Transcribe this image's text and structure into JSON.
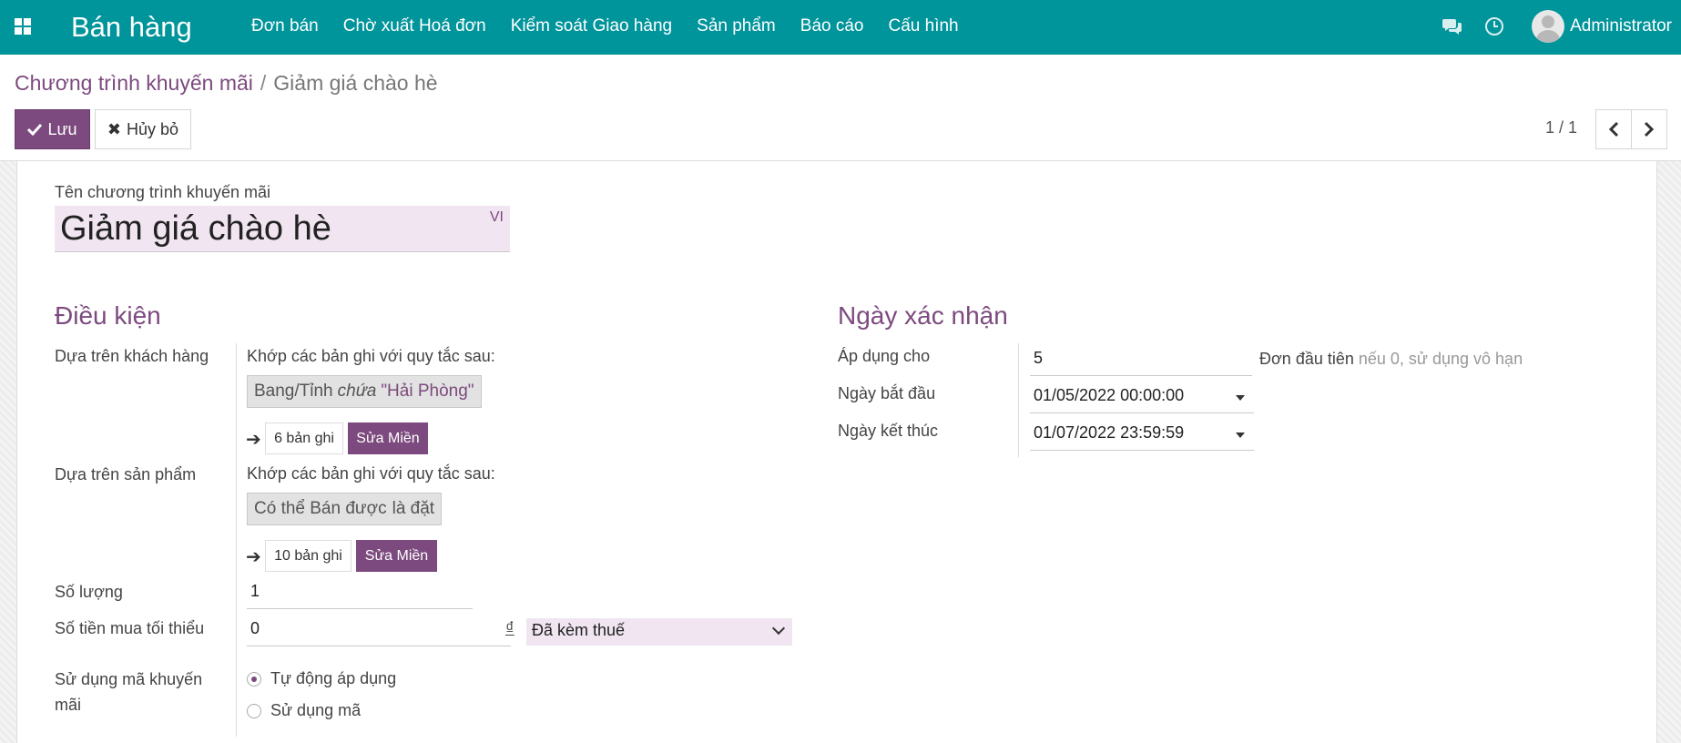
{
  "navbar": {
    "app_name": "Bán hàng",
    "menu": [
      "Đơn bán",
      "Chờ xuất Hoá đơn",
      "Kiểm soát Giao hàng",
      "Sản phẩm",
      "Báo cáo",
      "Cấu hình"
    ],
    "user": "Administrator",
    "bg_color": "#00949b",
    "icons": [
      "apps-icon",
      "chat-icon",
      "clock-icon",
      "avatar"
    ]
  },
  "breadcrumb": {
    "parent": "Chương trình khuyến mãi",
    "separator": "/",
    "current": "Giảm giá chào hè"
  },
  "buttons": {
    "save": "Lưu",
    "discard": "Hủy bỏ",
    "accent_color": "#7c4a7e"
  },
  "pager": {
    "value": "1 / 1"
  },
  "form": {
    "name_label": "Tên chương trình khuyến mãi",
    "name_value": "Giảm giá chào hè",
    "lang": "VI",
    "conditions": {
      "title": "Điều kiện",
      "customer_label": "Dựa trên khách hàng",
      "customer_rule_intro": "Khớp các bản ghi với quy tắc sau:",
      "customer_domain": {
        "field": "Bang/Tỉnh",
        "operator": "chứa",
        "value": "\"Hải Phòng\""
      },
      "customer_records": "6 bản ghi",
      "customer_edit": "Sửa Miền",
      "product_label": "Dựa trên sản phẩm",
      "product_rule_intro": "Khớp các bản ghi với quy tắc sau:",
      "product_domain": {
        "field": "Có thể Bán được",
        "operator": "là đặt"
      },
      "product_records": "10 bản ghi",
      "product_edit": "Sửa Miền",
      "quantity_label": "Số lượng",
      "quantity_value": "1",
      "min_amount_label": "Số tiền mua tối thiểu",
      "min_amount_value": "0",
      "currency": "₫",
      "tax_option": "Đã kèm thuế",
      "code_usage_label": "Sử dụng mã khuyến mãi",
      "code_options": [
        {
          "label": "Tự động áp dụng",
          "checked": true
        },
        {
          "label": "Sử dụng mã",
          "checked": false
        }
      ]
    },
    "validity": {
      "title": "Ngày xác nhận",
      "apply_label": "Áp dụng cho",
      "apply_value": "5",
      "apply_suffix": "Đơn đầu tiên",
      "apply_hint": "nếu 0, sử dụng vô hạn",
      "start_label": "Ngày bắt đầu",
      "start_value": "01/05/2022 00:00:00",
      "end_label": "Ngày kết thúc",
      "end_value": "01/07/2022 23:59:59"
    }
  }
}
